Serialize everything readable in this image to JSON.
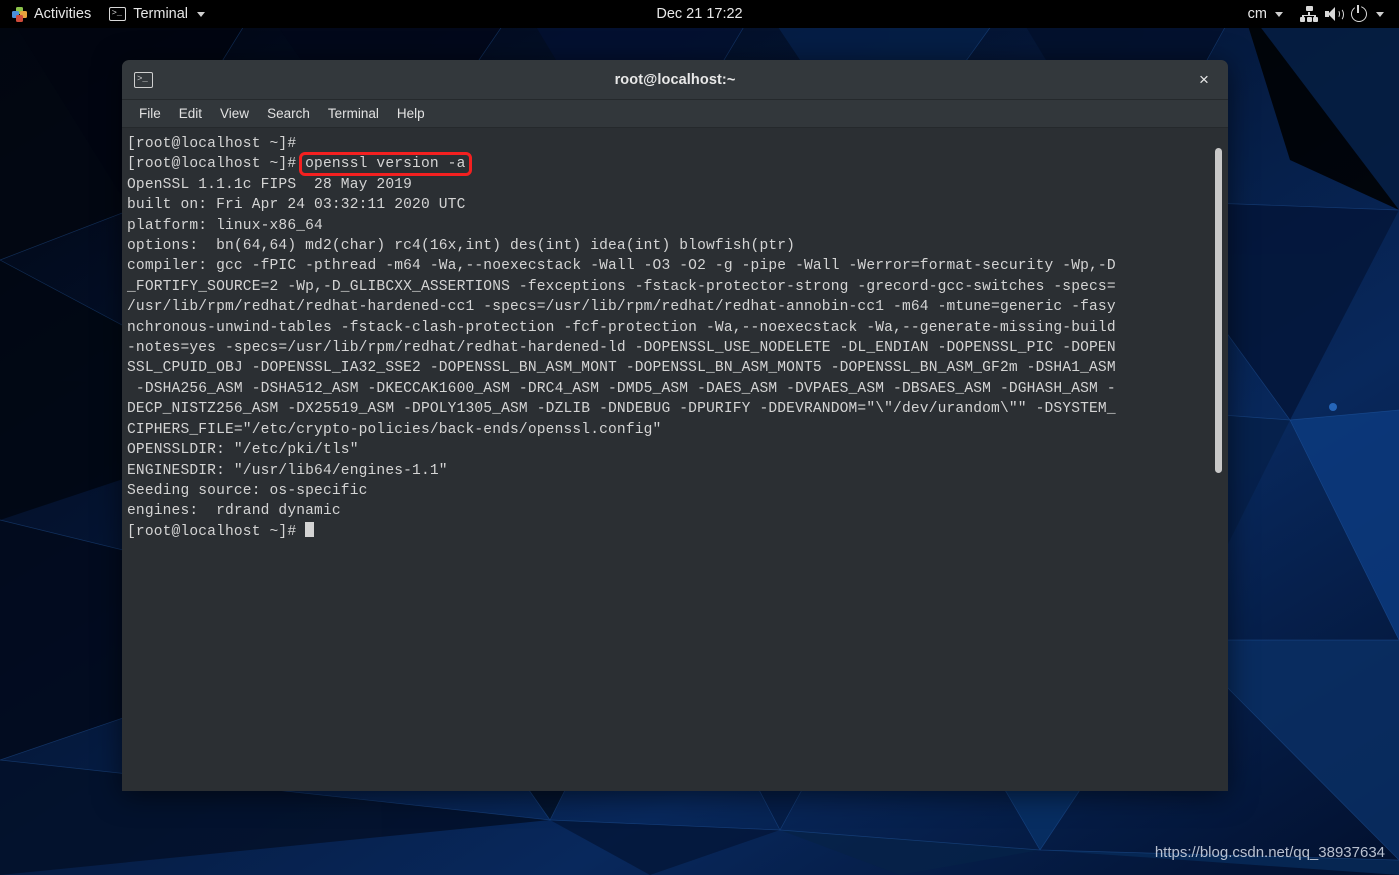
{
  "topbar": {
    "activities_label": "Activities",
    "activities_icon": "activities-grid-icon",
    "app_name": "Terminal",
    "app_icon": "terminal-icon",
    "app_caret_icon": "chevron-down-icon",
    "clock": "Dec 21  17:22",
    "input_source": "cm",
    "input_caret_icon": "chevron-down-icon",
    "network_icon": "network-wired-icon",
    "volume_icon": "volume-icon",
    "power_icon": "power-icon",
    "system_caret_icon": "chevron-down-icon"
  },
  "window": {
    "title": "root@localhost:~",
    "icon": "terminal-icon",
    "close_label": "×",
    "menu": [
      {
        "label": "File"
      },
      {
        "label": "Edit"
      },
      {
        "label": "View"
      },
      {
        "label": "Search"
      },
      {
        "label": "Terminal"
      },
      {
        "label": "Help"
      }
    ]
  },
  "terminal": {
    "prompt": "[root@localhost ~]#",
    "command": "openssl version -a",
    "highlight_color": "#f42020",
    "lines": [
      "[root@localhost ~]#",
      "[root@localhost ~]# openssl version -a",
      "OpenSSL 1.1.1c FIPS  28 May 2019",
      "built on: Fri Apr 24 03:32:11 2020 UTC",
      "platform: linux-x86_64",
      "options:  bn(64,64) md2(char) rc4(16x,int) des(int) idea(int) blowfish(ptr)",
      "compiler: gcc -fPIC -pthread -m64 -Wa,--noexecstack -Wall -O3 -O2 -g -pipe -Wall -Werror=format-security -Wp,-D",
      "_FORTIFY_SOURCE=2 -Wp,-D_GLIBCXX_ASSERTIONS -fexceptions -fstack-protector-strong -grecord-gcc-switches -specs=",
      "/usr/lib/rpm/redhat/redhat-hardened-cc1 -specs=/usr/lib/rpm/redhat/redhat-annobin-cc1 -m64 -mtune=generic -fasy",
      "nchronous-unwind-tables -fstack-clash-protection -fcf-protection -Wa,--noexecstack -Wa,--generate-missing-build",
      "-notes=yes -specs=/usr/lib/rpm/redhat/redhat-hardened-ld -DOPENSSL_USE_NODELETE -DL_ENDIAN -DOPENSSL_PIC -DOPEN",
      "SSL_CPUID_OBJ -DOPENSSL_IA32_SSE2 -DOPENSSL_BN_ASM_MONT -DOPENSSL_BN_ASM_MONT5 -DOPENSSL_BN_ASM_GF2m -DSHA1_ASM",
      " -DSHA256_ASM -DSHA512_ASM -DKECCAK1600_ASM -DRC4_ASM -DMD5_ASM -DAES_ASM -DVPAES_ASM -DBSAES_ASM -DGHASH_ASM -",
      "DECP_NISTZ256_ASM -DX25519_ASM -DPOLY1305_ASM -DZLIB -DNDEBUG -DPURIFY -DDEVRANDOM=\"\\\"/dev/urandom\\\"\" -DSYSTEM_",
      "CIPHERS_FILE=\"/etc/crypto-policies/back-ends/openssl.config\"",
      "OPENSSLDIR: \"/etc/pki/tls\"",
      "ENGINESDIR: \"/usr/lib64/engines-1.1\"",
      "Seeding source: os-specific",
      "engines:  rdrand dynamic",
      "[root@localhost ~]# "
    ]
  },
  "watermark": {
    "text": "https://blog.csdn.net/qq_38937634"
  }
}
